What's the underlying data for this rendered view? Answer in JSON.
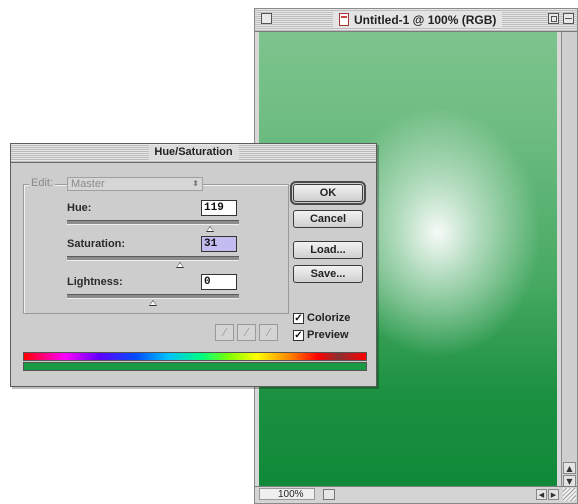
{
  "document": {
    "title": "Untitled-1 @ 100% (RGB)",
    "zoom": "100%"
  },
  "dialog": {
    "title": "Hue/Saturation",
    "edit_label": "Edit:",
    "edit_value": "Master",
    "fields": {
      "hue": {
        "label": "Hue:",
        "value": "119",
        "range": [
          -180,
          180
        ]
      },
      "saturation": {
        "label": "Saturation:",
        "value": "31",
        "range": [
          -100,
          100
        ]
      },
      "lightness": {
        "label": "Lightness:",
        "value": "0",
        "range": [
          -100,
          100
        ]
      }
    },
    "buttons": {
      "ok": "OK",
      "cancel": "Cancel",
      "load": "Load...",
      "save": "Save..."
    },
    "checkboxes": {
      "colorize": {
        "label": "Colorize",
        "checked": true
      },
      "preview": {
        "label": "Preview",
        "checked": true
      }
    },
    "colors": {
      "result_bar": "#1a9a45",
      "saturation_highlight": "#c3bcf0"
    }
  },
  "icons": {
    "eyedroppers": [
      "eyedropper-icon",
      "eyedropper-plus-icon",
      "eyedropper-minus-icon"
    ]
  }
}
